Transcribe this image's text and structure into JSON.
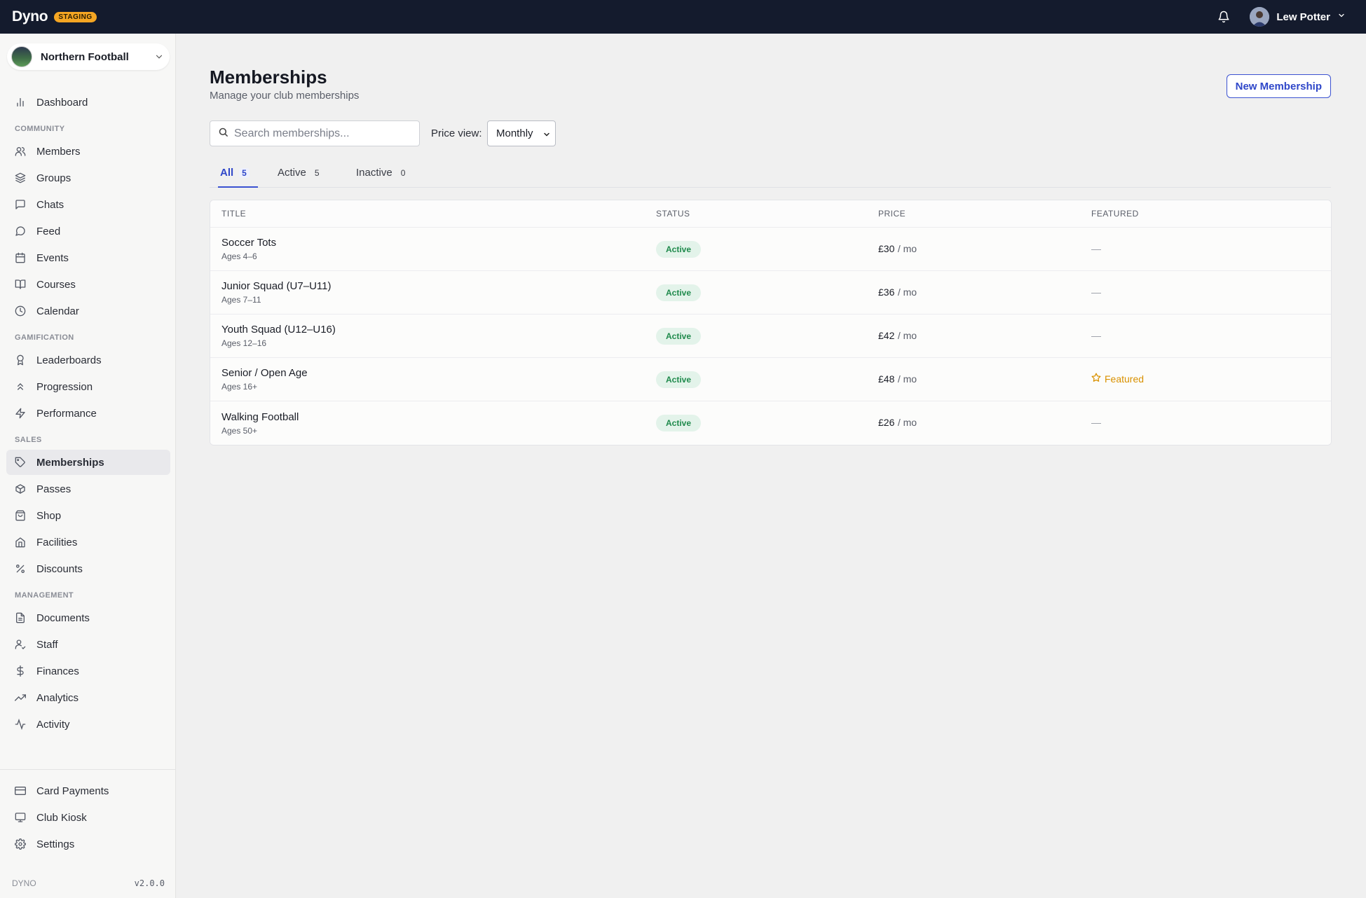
{
  "topbar": {
    "brand": "Dyno",
    "env_badge": "STAGING",
    "user_name": "Lew Potter"
  },
  "sidebar": {
    "org_name": "Northern Football",
    "items": [
      {
        "label": "Dashboard",
        "icon": "bar-chart-icon"
      },
      {
        "label": "Members",
        "icon": "users-icon"
      },
      {
        "label": "Groups",
        "icon": "layers-icon"
      },
      {
        "label": "Chats",
        "icon": "message-square-icon"
      },
      {
        "label": "Feed",
        "icon": "message-circle-icon"
      },
      {
        "label": "Events",
        "icon": "calendar-icon"
      },
      {
        "label": "Courses",
        "icon": "book-open-icon"
      },
      {
        "label": "Calendar",
        "icon": "clock-icon"
      },
      {
        "label": "Leaderboards",
        "icon": "award-icon"
      },
      {
        "label": "Progression",
        "icon": "chevrons-up-icon"
      },
      {
        "label": "Performance",
        "icon": "zap-icon"
      },
      {
        "label": "Memberships",
        "icon": "tag-icon"
      },
      {
        "label": "Passes",
        "icon": "package-icon"
      },
      {
        "label": "Shop",
        "icon": "shopping-bag-icon"
      },
      {
        "label": "Facilities",
        "icon": "home-icon"
      },
      {
        "label": "Discounts",
        "icon": "percent-icon"
      },
      {
        "label": "Documents",
        "icon": "file-text-icon"
      },
      {
        "label": "Staff",
        "icon": "user-check-icon"
      },
      {
        "label": "Finances",
        "icon": "dollar-icon"
      },
      {
        "label": "Analytics",
        "icon": "trending-up-icon"
      },
      {
        "label": "Activity",
        "icon": "activity-icon"
      }
    ],
    "sections": {
      "community": "COMMUNITY",
      "gamification": "GAMIFICATION",
      "sales": "SALES",
      "management": "MANAGEMENT"
    },
    "bottom_items": [
      {
        "label": "Card Payments",
        "icon": "credit-card-icon"
      },
      {
        "label": "Club Kiosk",
        "icon": "monitor-icon"
      },
      {
        "label": "Settings",
        "icon": "gear-icon"
      }
    ],
    "footer_brand": "DYNO",
    "footer_version": "v2.0.0"
  },
  "main": {
    "title": "Memberships",
    "subtitle": "Manage your club memberships",
    "new_button": "New Membership",
    "search_placeholder": "Search memberships...",
    "price_view_label": "Price view:",
    "price_view_value": "Monthly",
    "tabs": [
      {
        "label": "All",
        "count": "5"
      },
      {
        "label": "Active",
        "count": "5"
      },
      {
        "label": "Inactive",
        "count": "0"
      }
    ],
    "columns": [
      "TITLE",
      "STATUS",
      "PRICE",
      "FEATURED"
    ],
    "rows": [
      {
        "title": "Soccer Tots",
        "sub": "Ages 4–6",
        "status": "Active",
        "price": "£30",
        "unit": "/ mo",
        "featured": "—"
      },
      {
        "title": "Junior Squad (U7–U11)",
        "sub": "Ages 7–11",
        "status": "Active",
        "price": "£36",
        "unit": "/ mo",
        "featured": "—"
      },
      {
        "title": "Youth Squad (U12–U16)",
        "sub": "Ages 12–16",
        "status": "Active",
        "price": "£42",
        "unit": "/ mo",
        "featured": "—"
      },
      {
        "title": "Senior / Open Age",
        "sub": "Ages 16+",
        "status": "Active",
        "price": "£48",
        "unit": "/ mo",
        "featured": "Featured"
      },
      {
        "title": "Walking Football",
        "sub": "Ages 50+",
        "status": "Active",
        "price": "£26",
        "unit": "/ mo",
        "featured": "—"
      }
    ]
  }
}
